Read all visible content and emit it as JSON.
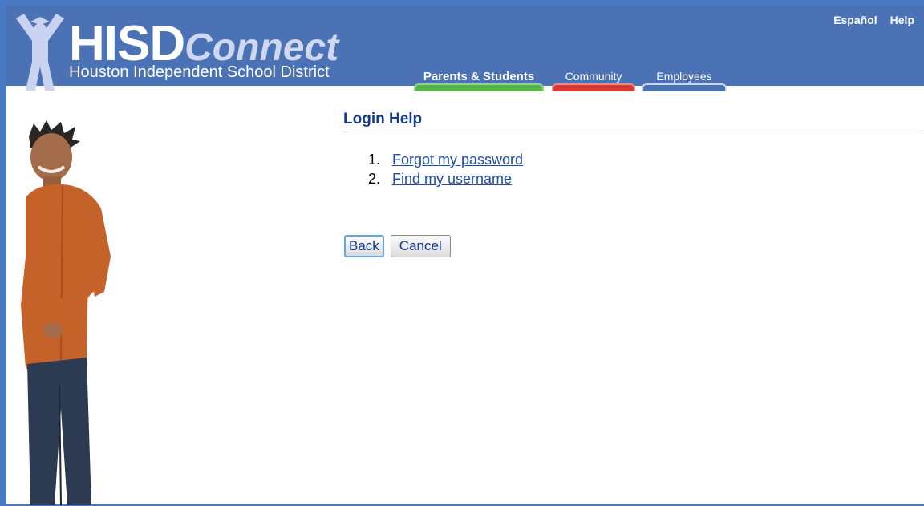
{
  "header": {
    "brand_main": "HISD",
    "brand_connect": "Connect",
    "subtitle": "Houston Independent School District",
    "util_links": [
      "Español",
      "Help"
    ],
    "tabs": [
      {
        "label": "Parents & Students"
      },
      {
        "label": "Community"
      },
      {
        "label": "Employees"
      }
    ]
  },
  "main": {
    "title": "Login Help",
    "items": [
      {
        "num": "1.",
        "label": "Forgot my password"
      },
      {
        "num": "2.",
        "label": "Find my username"
      }
    ],
    "buttons": {
      "back": "Back",
      "cancel": "Cancel"
    }
  },
  "colors": {
    "header_bg": "#4a72b5",
    "tab_parents": "#54b64b",
    "tab_community": "#d83a36",
    "link": "#1e4ca7",
    "title": "#173b8c"
  }
}
